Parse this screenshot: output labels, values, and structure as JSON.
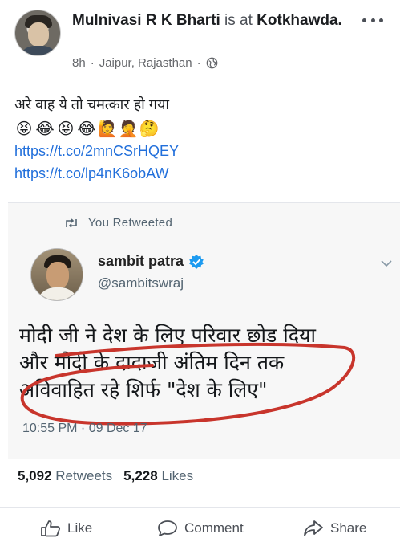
{
  "post": {
    "author": "Mulnivasi R K Bharti",
    "is_at": "is at",
    "location_name": "Kotkhawda.",
    "time": "8h",
    "separator": "·",
    "place": "Jaipur, Rajasthan",
    "text": "अरे वाह ये तो चमत्कार हो गया",
    "emojis": [
      "😝",
      "😂",
      "😝",
      "😂",
      "🙋",
      "🤦",
      "🤔"
    ],
    "links": [
      "https://t.co/2mnCSrHQEY",
      "https://t.co/lp4nK6obAW"
    ]
  },
  "tweet": {
    "retweet_label": "You Retweeted",
    "name": "sambit patra",
    "handle": "@sambitswraj",
    "lines": [
      "मोदी जी ने देश के लिए परिवार छोड़ दिया",
      "और मोदी के दादाजी अंतिम दिन तक",
      "अविवाहित रहे शिर्फ \"देश के लिए\""
    ],
    "timestamp": "10:55 PM · 09 Dec 17",
    "retweets_count": "5,092",
    "retweets_label": "Retweets",
    "likes_count": "5,228",
    "likes_label": "Likes",
    "annotation_color": "#c8352c"
  },
  "actions": {
    "like": "Like",
    "comment": "Comment",
    "share": "Share"
  }
}
